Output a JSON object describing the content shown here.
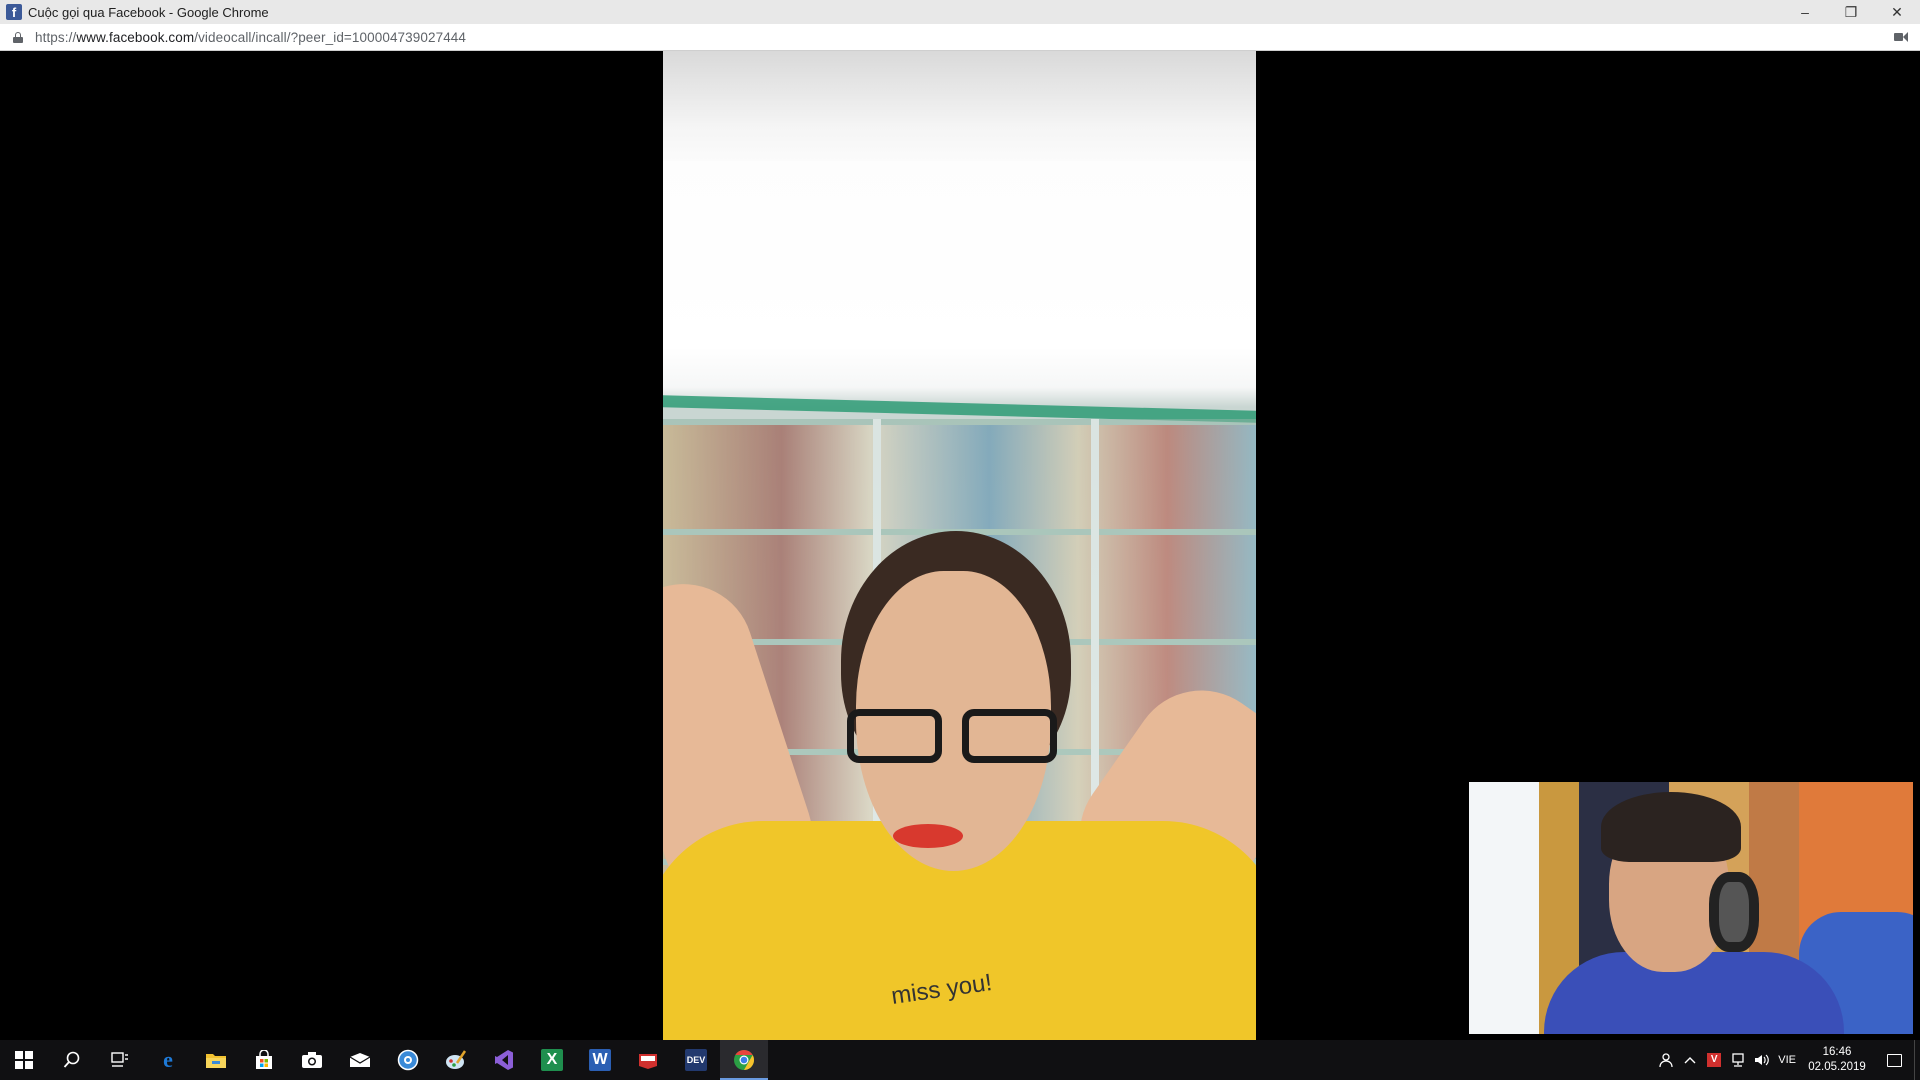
{
  "window": {
    "title": "Cuộc gọi qua Facebook - Google Chrome",
    "controls": {
      "minimize": "–",
      "restore": "❐",
      "close": "✕"
    }
  },
  "addressbar": {
    "url_prefix": "https://",
    "url_host": "www.facebook.com",
    "url_path": "/videocall/incall/?peer_id=100004739027444"
  },
  "videocall": {
    "remote_shirt_text": "miss you!"
  },
  "taskbar": {
    "apps": [
      {
        "icon": "start-icon"
      },
      {
        "icon": "search-icon"
      },
      {
        "icon": "task-view-icon"
      },
      {
        "icon": "edge-icon",
        "color": "#1e7ad8"
      },
      {
        "icon": "file-explorer-icon",
        "color": "#f2c230"
      },
      {
        "icon": "store-icon",
        "color": "#ffffff"
      },
      {
        "icon": "camera-icon",
        "color": "#ffffff"
      },
      {
        "icon": "mail-icon",
        "color": "#ffffff"
      },
      {
        "icon": "settings-app-icon",
        "color": "#3a8ad8"
      },
      {
        "icon": "paint-icon",
        "color": "#8bc1e6"
      },
      {
        "icon": "visual-studio-icon",
        "color": "#8c5fd8"
      },
      {
        "icon": "excel-icon",
        "color": "#1f8f4e"
      },
      {
        "icon": "word-icon",
        "color": "#2b5fb3"
      },
      {
        "icon": "red-app-icon",
        "color": "#d0302e"
      },
      {
        "icon": "devcpp-icon",
        "color": "#22396e"
      },
      {
        "icon": "chrome-icon",
        "color": "#e8453c"
      }
    ],
    "tray": {
      "language": "VIE",
      "time": "16:46",
      "date": "02.05.2019"
    }
  }
}
